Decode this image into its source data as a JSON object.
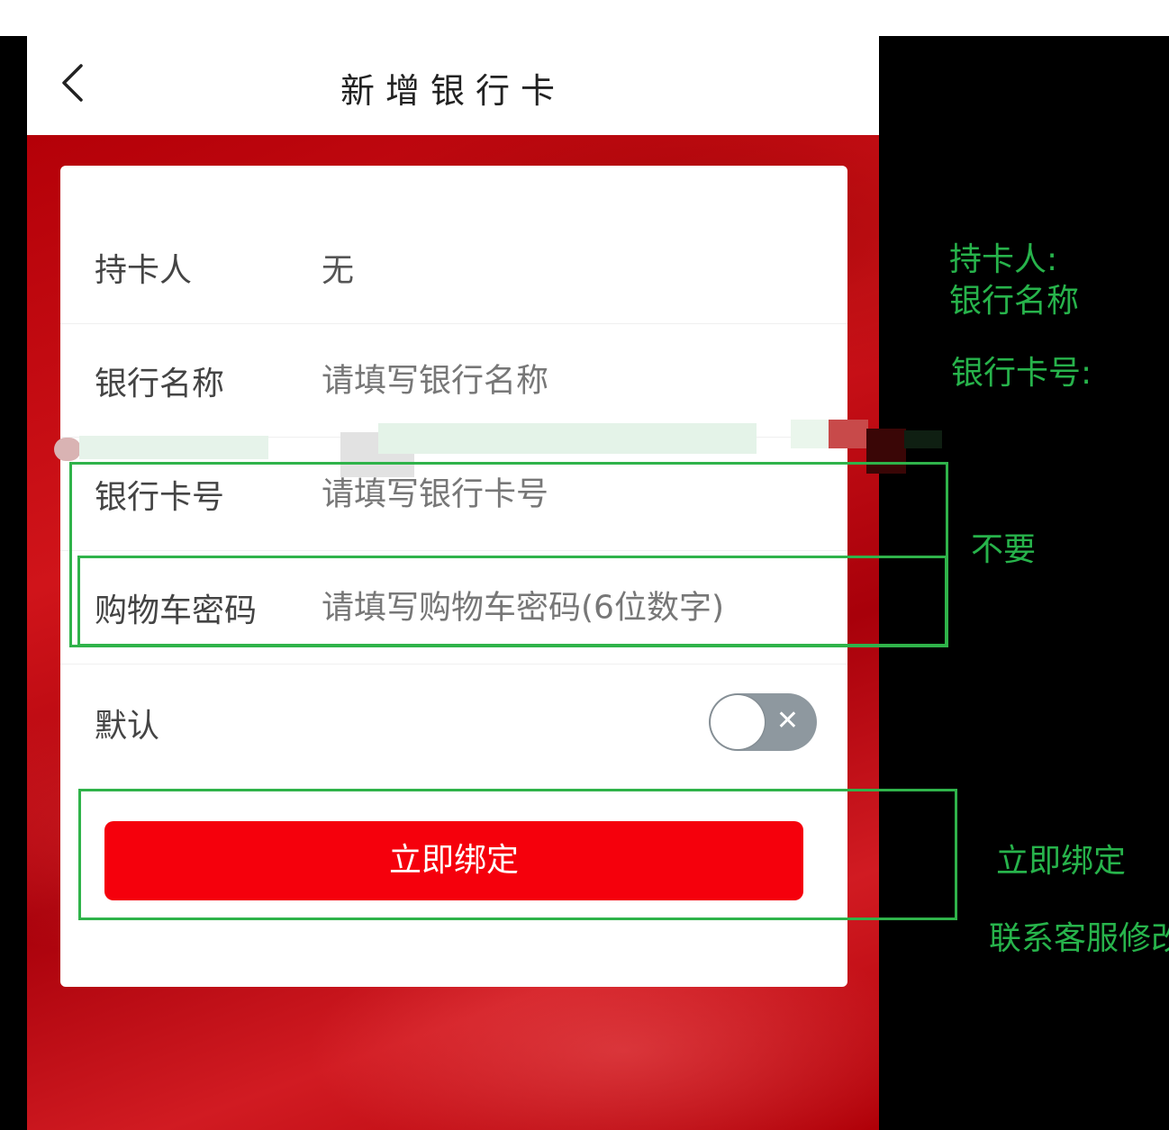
{
  "header": {
    "title": "新增银行卡"
  },
  "form": {
    "holder": {
      "label": "持卡人",
      "value": "无"
    },
    "bank_name": {
      "label": "银行名称",
      "placeholder": "请填写银行名称"
    },
    "card_number": {
      "label": "银行卡号",
      "placeholder": "请填写银行卡号"
    },
    "cart_password": {
      "label": "购物车密码",
      "placeholder": "请填写购物车密码(6位数字)"
    },
    "default": {
      "label": "默认",
      "toggle_on": false,
      "toggle_glyph": "✕"
    },
    "submit_label": "立即绑定"
  },
  "annotations": {
    "fields_note_line1": "持卡人:",
    "fields_note_line2": "银行名称",
    "fields_note_line3": "银行卡号:",
    "remove_note": "不要",
    "bind_note": "立即绑定",
    "contact_note": "联系客服修改"
  },
  "colors": {
    "accent_red": "#f5000c",
    "annotation_green": "#2fb34a"
  }
}
